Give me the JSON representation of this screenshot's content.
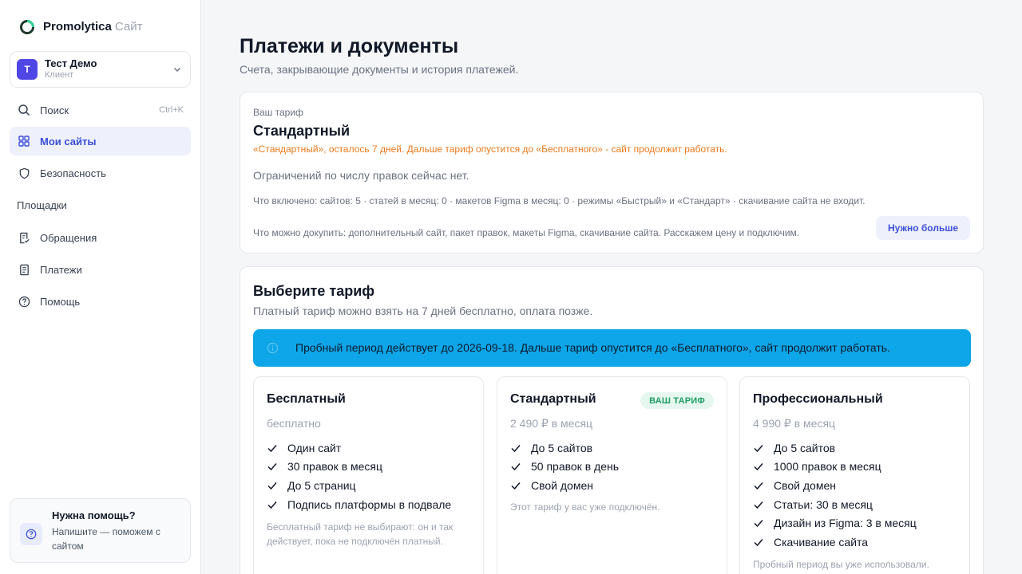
{
  "brand": {
    "name": "Promolytica",
    "suffix": "Сайт"
  },
  "account": {
    "initial": "Т",
    "name": "Тест Демо",
    "role": "Клиент"
  },
  "sidebar": {
    "search": {
      "label": "Поиск",
      "shortcut": "Ctrl+K"
    },
    "items": [
      {
        "label": "Мои сайты",
        "icon": "grid-icon",
        "active": true
      },
      {
        "label": "Безопасность",
        "icon": "shield-icon"
      }
    ],
    "section": "Площадки",
    "items2": [
      {
        "label": "Обращения",
        "icon": "ticket-icon"
      },
      {
        "label": "Платежи",
        "icon": "receipt-icon"
      },
      {
        "label": "Помощь",
        "icon": "help-circle-icon"
      }
    ]
  },
  "help": {
    "title": "Нужна помощь?",
    "text": "Напишите — поможем с сайтом"
  },
  "page": {
    "title": "Платежи и документы",
    "subtitle": "Счета, закрывающие документы и история платежей."
  },
  "current_tariff": {
    "label": "Ваш тариф",
    "name": "Стандартный",
    "warning": "«Стандартный», осталось 7 дней. Дальше тариф опустится до «Бесплатного» - сайт продолжит работать.",
    "limits": "Ограничений по числу правок сейчас нет.",
    "included": "Что включено: сайтов: 5 · статей в месяц: 0 · макетов Figma в месяц: 0 · режимы «Быстрый» и «Стандарт» · скачивание сайта не входит.",
    "buy": "Что можно докупить: дополнительный сайт, пакет правок, макеты Figma, скачивание сайта. Расскажем цену и подключим.",
    "more_button": "Нужно больше"
  },
  "plans_section": {
    "title": "Выберите тариф",
    "subtitle": "Платный тариф можно взять на 7 дней бесплатно, оплата позже.",
    "banner": "Пробный период действует до 2026-09-18. Дальше тариф опустится до «Бесплатного», сайт продолжит работать."
  },
  "plans": [
    {
      "name": "Бесплатный",
      "price": "бесплатно",
      "features": [
        "Один сайт",
        "30 правок в месяц",
        "До 5 страниц",
        "Подпись платформы в подвале"
      ],
      "note": "Бесплатный тариф не выбирают: он и так действует, пока не подключён платный."
    },
    {
      "name": "Стандартный",
      "price": "2 490 ₽ в месяц",
      "badge": "ВАШ ТАРИФ",
      "features": [
        "До 5 сайтов",
        "50 правок в день",
        "Свой домен"
      ],
      "note": "Этот тариф у вас уже подключён."
    },
    {
      "name": "Профессиональный",
      "price": "4 990 ₽ в месяц",
      "features": [
        "До 5 сайтов",
        "1000 правок в месяц",
        "Свой домен",
        "Статьи: 30 в месяц",
        "Дизайн из Figma: 3 в месяц",
        "Скачивание сайта"
      ],
      "note": "Пробный период вы уже использовали."
    }
  ],
  "colors": {
    "accent": "#3b4fd8",
    "avatar": "#4f46e5",
    "warning": "#ea7a1c",
    "banner": "#0ea5e9",
    "badge": "#1f9d63"
  }
}
